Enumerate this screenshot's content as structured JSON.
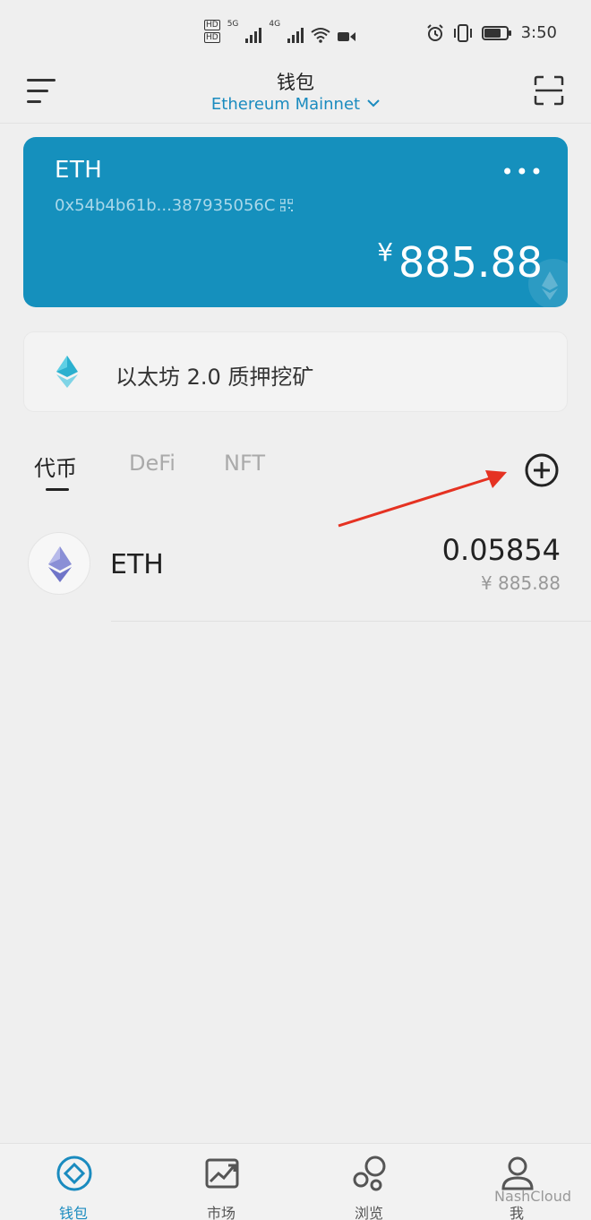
{
  "statusbar": {
    "hd1": "HD",
    "hd2": "HD",
    "sig1": "5G",
    "sig2": "4G",
    "time": "3:50"
  },
  "header": {
    "title": "钱包",
    "network": "Ethereum Mainnet"
  },
  "card": {
    "name": "ETH",
    "address": "0x54b4b61b...387935056C",
    "currency": "¥",
    "balance": "885.88"
  },
  "staking": {
    "label": "以太坊 2.0 质押挖矿"
  },
  "tabs": [
    {
      "label": "代币"
    },
    {
      "label": "DeFi"
    },
    {
      "label": "NFT"
    }
  ],
  "tokens": [
    {
      "name": "ETH",
      "amount": "0.05854",
      "fiat": "¥ 885.88"
    }
  ],
  "bottom_nav": [
    {
      "label": "钱包"
    },
    {
      "label": "市场"
    },
    {
      "label": "浏览"
    },
    {
      "label": "我"
    }
  ],
  "watermark": "NashCloud",
  "colors": {
    "accent": "#1590bd",
    "link": "#1a8bbf",
    "arrow": "#e53222"
  }
}
